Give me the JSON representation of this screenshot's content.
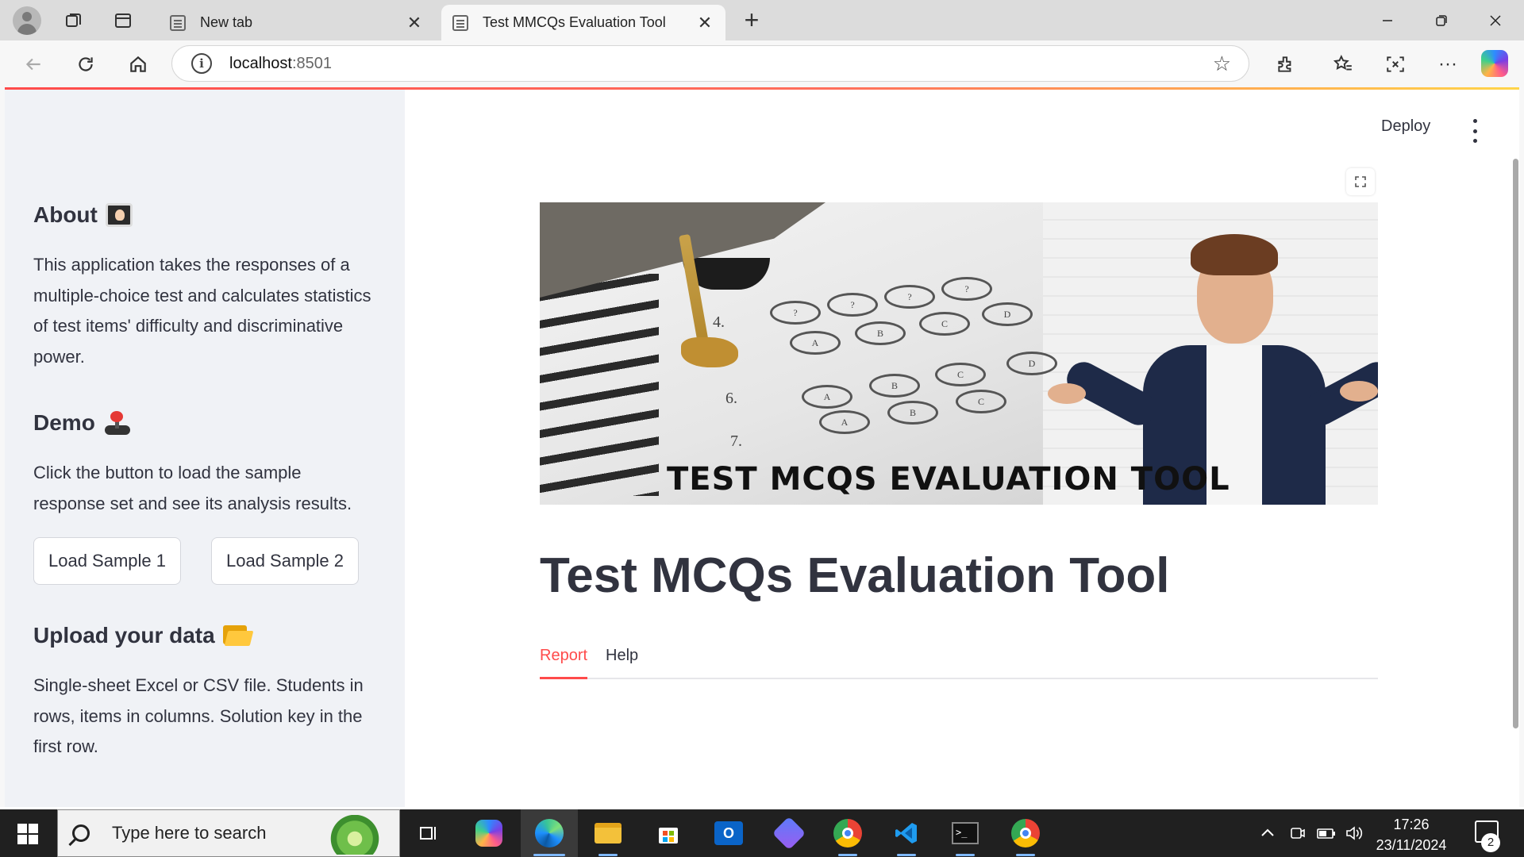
{
  "browser": {
    "tabs": [
      {
        "title": "New tab",
        "active": false
      },
      {
        "title": "Test MMCQs Evaluation Tool",
        "active": true
      }
    ],
    "url_host": "localhost",
    "url_port": ":8501"
  },
  "app": {
    "header": {
      "deploy_label": "Deploy"
    },
    "sidebar": {
      "about": {
        "heading": "About",
        "icon": "technologist-monitor-icon",
        "text": "This application takes the responses of a multiple-choice test and calculates statistics of test items' difficulty and discriminative power."
      },
      "demo": {
        "heading": "Demo",
        "icon": "joystick-icon",
        "text": "Click the button to load the sample response set and see its analysis results.",
        "buttons": [
          "Load Sample 1",
          "Load Sample 2"
        ]
      },
      "upload": {
        "heading": "Upload your data",
        "icon": "open-folder-icon",
        "text": "Single-sheet Excel or CSV file. Students in rows, items in columns. Solution key in the first row."
      }
    },
    "main": {
      "banner_text": "TEST MCQS EVALUATION TOOL",
      "banner_bubbles": [
        "A",
        "B",
        "C",
        "D",
        "A",
        "B",
        "C",
        "D",
        "A",
        "B",
        "C",
        "?",
        "?",
        "?",
        "?",
        "6.",
        "7.",
        "4."
      ],
      "title": "Test MCQs Evaluation Tool",
      "tabs": [
        {
          "label": "Report",
          "active": true
        },
        {
          "label": "Help",
          "active": false
        }
      ]
    },
    "accent_color": "#ff4b4b"
  },
  "taskbar": {
    "search_placeholder": "Type here to search",
    "time": "17:26",
    "date": "23/11/2024",
    "notification_count": "2"
  }
}
